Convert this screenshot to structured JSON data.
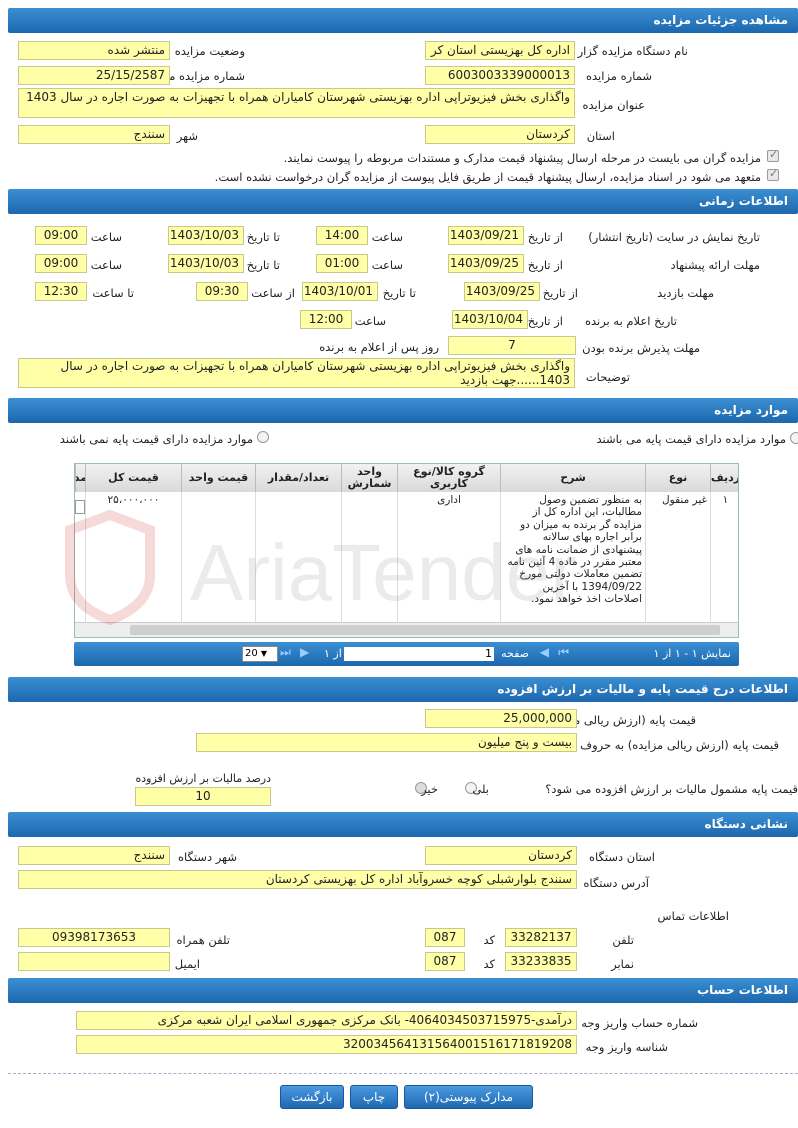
{
  "sections": {
    "details": "مشاهده جزئیات مزایده",
    "time": "اطلاعات زمانی",
    "items": "موارد مزایده",
    "price": "اطلاعات درج قیمت پایه و مالیات بر ارزش افزوده",
    "address": "نشانی دستگاه",
    "account": "اطلاعات حساب"
  },
  "details": {
    "org_label": "نام دستگاه مزایده گزار",
    "org_value": "اداره کل بهزیستی استان کر",
    "status_label": "وضعیت مزایده",
    "status_value": "منتشر شده",
    "number_label": "شماره مزایده",
    "number_value": "6003003339000013",
    "ref_label": "شماره مزایده مرجع",
    "ref_value": "25/15/2587",
    "title_label": "عنوان مزایده",
    "title_value": "واگذاری بخش فیزیوتراپی اداره بهزیستی شهرستان کامیاران همراه با تجهیزات به صورت اجاره در سال 1403",
    "province_label": "استان",
    "province_value": "کردستان",
    "city_label": "شهر",
    "city_value": "سنندج",
    "check1": "مزایده گران می بایست در مرحله ارسال پیشنهاد قیمت مدارک و مستندات مربوطه را پیوست نمایند.",
    "check2": "متعهد می شود در اسناد مزایده، ارسال پیشنهاد قیمت از طریق فایل پیوست از مزایده گران درخواست نشده است."
  },
  "time": {
    "site_label": "تاریخ نمایش در سایت (تاریخ انتشار)",
    "from_date": "از تاریخ",
    "to_date": "تا تاریخ",
    "hour": "ساعت",
    "to_hour": "تا ساعت",
    "from_hour": "از ساعت",
    "site_from": "1403/09/21",
    "site_from_time": "14:00",
    "site_to": "1403/10/03",
    "site_to_time": "09:00",
    "offer_label": "مهلت ارائه پیشنهاد",
    "offer_from": "1403/09/25",
    "offer_from_time": "01:00",
    "offer_to": "1403/10/03",
    "offer_to_time": "09:00",
    "visit_label": "مهلت بازدید",
    "visit_from": "1403/09/25",
    "visit_to": "1403/10/01",
    "visit_from_time": "09:30",
    "visit_to_time": "12:30",
    "announce_label": "تاریخ اعلام به برنده",
    "announce_date": "1403/10/04",
    "announce_time": "12:00",
    "accept_label": "مهلت پذیرش برنده بودن",
    "accept_days": "7",
    "accept_suffix": "روز پس از اعلام به برنده",
    "desc_label": "توضیحات",
    "desc_value": "واگذاری بخش فیزیوتراپی اداره بهزیستی شهرستان کامیاران همراه با تجهیزات به صورت اجاره در سال 1403......جهت بازدید"
  },
  "items": {
    "radio_with": "موارد مزایده دارای قیمت پایه می باشند",
    "radio_without": "موارد مزایده دارای قیمت پایه نمی باشند",
    "headers": {
      "row": "ردیف",
      "type": "نوع",
      "desc": "شرح",
      "group": "گروه کالا/نوع کاربری",
      "unit": "واحد شمارش",
      "qty": "تعداد/مقدار",
      "unit_price": "قیمت واحد",
      "total": "قیمت کل",
      "more": "مد"
    },
    "row": {
      "num": "۱",
      "type": "غیر منقول",
      "desc": "به منظور تضمین وصول مطالبات، این اداره کل از مزایده گر برنده به میزان دو برابر اجاره بهای سالانه پیشنهادی از ضمانت نامه های معتبر مقرر در ماده 4 آئین نامه تضمین معاملات دولتی مورخ 1394/09/22 با آخرین اصلاحات اخذ خواهد نمود.",
      "group": "اداری",
      "total": "۲۵،۰۰۰،۰۰۰"
    },
    "pager": {
      "view": "نمایش ۱ - ۱ از ۱",
      "page": "صفحه",
      "page_num": "1",
      "of": "از ۱",
      "size": "20"
    }
  },
  "price": {
    "num_label": "قیمت پایه (ارزش ریالی مزایده) به عدد",
    "num_value": "25,000,000",
    "text_label": "قیمت پایه (ارزش ریالی مزایده) به حروف",
    "text_value": "بیست و پنج میلیون",
    "vat_q": "قیمت پایه مشمول مالیات بر ارزش افزوده می شود؟",
    "yes": "بلی",
    "no": "خیر",
    "vat_pct_label": "درصد مالیات بر ارزش افزوده",
    "vat_pct": "10"
  },
  "address": {
    "province_label": "استان دستگاه",
    "province_value": "کردستان",
    "city_label": "شهر دستگاه",
    "city_value": "سنندج",
    "addr_label": "آدرس دستگاه",
    "addr_value": "سنندج بلوارشبلی کوچه خسروآباد اداره کل بهزیستی کردستان",
    "contact_label": "اطلاعات تماس",
    "phone_label": "تلفن",
    "phone_value": "33282137",
    "code_label": "کد",
    "phone_code": "087",
    "fax_label": "نمابر",
    "fax_value": "33233835",
    "fax_code": "087",
    "mobile_label": "تلفن همراه",
    "mobile_value": "09398173653",
    "email_label": "ایمیل",
    "email_value": ""
  },
  "account": {
    "acc_label": "شماره حساب واریز وجه",
    "acc_value": "درآمدی-4064034503715975- بانک مرکزی جمهوری اسلامی ایران شعبه مرکزی",
    "id_label": "شناسه واریز وجه",
    "id_value": "320034564131564001516171819208"
  },
  "buttons": {
    "attachments": "مدارک پیوستی(۲)",
    "print": "چاپ",
    "back": "بازگشت"
  },
  "watermark": "AriaTender"
}
